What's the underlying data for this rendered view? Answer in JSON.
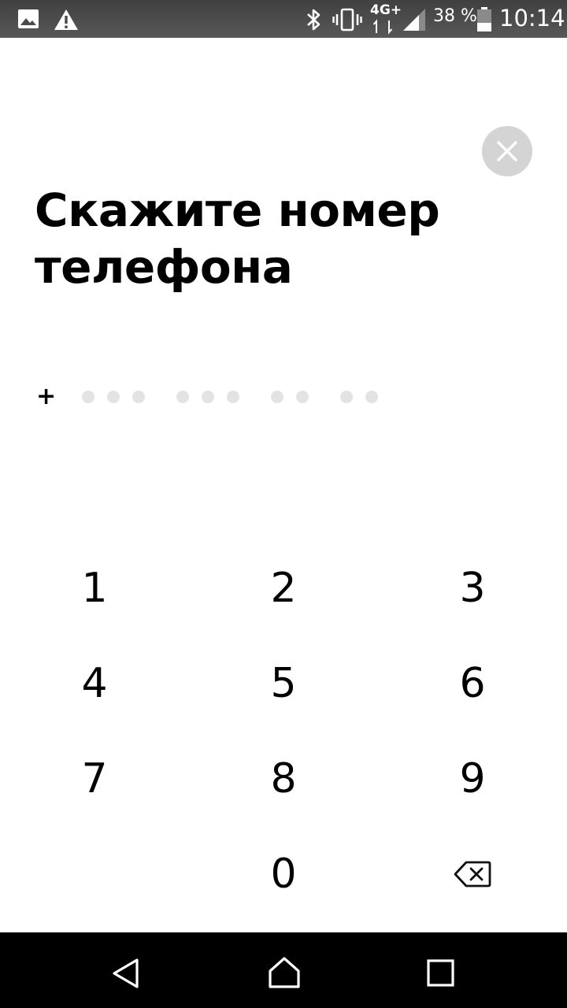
{
  "status_bar": {
    "network_type": "4G+",
    "battery_percent": "38 %",
    "time": "10:14",
    "icons": [
      "gallery-icon",
      "warning-icon",
      "bluetooth-icon",
      "vibrate-icon",
      "data-arrows-icon",
      "signal-icon",
      "battery-icon"
    ]
  },
  "close_button": {
    "icon": "close-icon"
  },
  "title": "Скажите номер телефона",
  "phone_input": {
    "prefix": "+",
    "digit_groups": [
      3,
      3,
      2,
      2
    ]
  },
  "keypad": {
    "keys": [
      "1",
      "2",
      "3",
      "4",
      "5",
      "6",
      "7",
      "8",
      "9",
      "0"
    ],
    "backspace_icon": "backspace-icon"
  },
  "nav_bar": {
    "icons": [
      "back-icon",
      "home-icon",
      "recents-icon"
    ]
  }
}
